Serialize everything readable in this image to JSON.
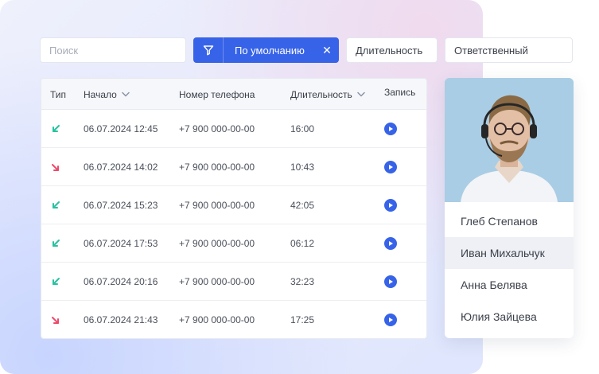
{
  "filters": {
    "search_placeholder": "Поиск",
    "preset_label": "По умолчанию",
    "close_symbol": "✕",
    "duration_label": "Длительность",
    "owner_label": "Ответственный"
  },
  "table": {
    "columns": {
      "type": "Тип",
      "start": "Начало",
      "phone": "Номер телефона",
      "duration": "Длительность",
      "record": "Запись"
    },
    "rows": [
      {
        "direction": "incoming",
        "start": "06.07.2024 12:45",
        "phone": "+7 900 000-00-00",
        "duration": "16:00"
      },
      {
        "direction": "outgoing",
        "start": "06.07.2024 14:02",
        "phone": "+7 900 000-00-00",
        "duration": "10:43"
      },
      {
        "direction": "incoming",
        "start": "06.07.2024 15:23",
        "phone": "+7 900 000-00-00",
        "duration": "42:05"
      },
      {
        "direction": "incoming",
        "start": "06.07.2024 17:53",
        "phone": "+7 900 000-00-00",
        "duration": "06:12"
      },
      {
        "direction": "incoming",
        "start": "06.07.2024 20:16",
        "phone": "+7 900 000-00-00",
        "duration": "32:23"
      },
      {
        "direction": "outgoing",
        "start": "06.07.2024 21:43",
        "phone": "+7 900 000-00-00",
        "duration": "17:25"
      }
    ]
  },
  "people": [
    {
      "name": "Глеб Степанов"
    },
    {
      "name": "Иван Михальчук",
      "active": true
    },
    {
      "name": "Анна Белява"
    },
    {
      "name": "Юлия Зайцева"
    }
  ],
  "colors": {
    "accent": "#3763e8",
    "incoming": "#27c2a0",
    "outgoing": "#ec4b6a"
  }
}
